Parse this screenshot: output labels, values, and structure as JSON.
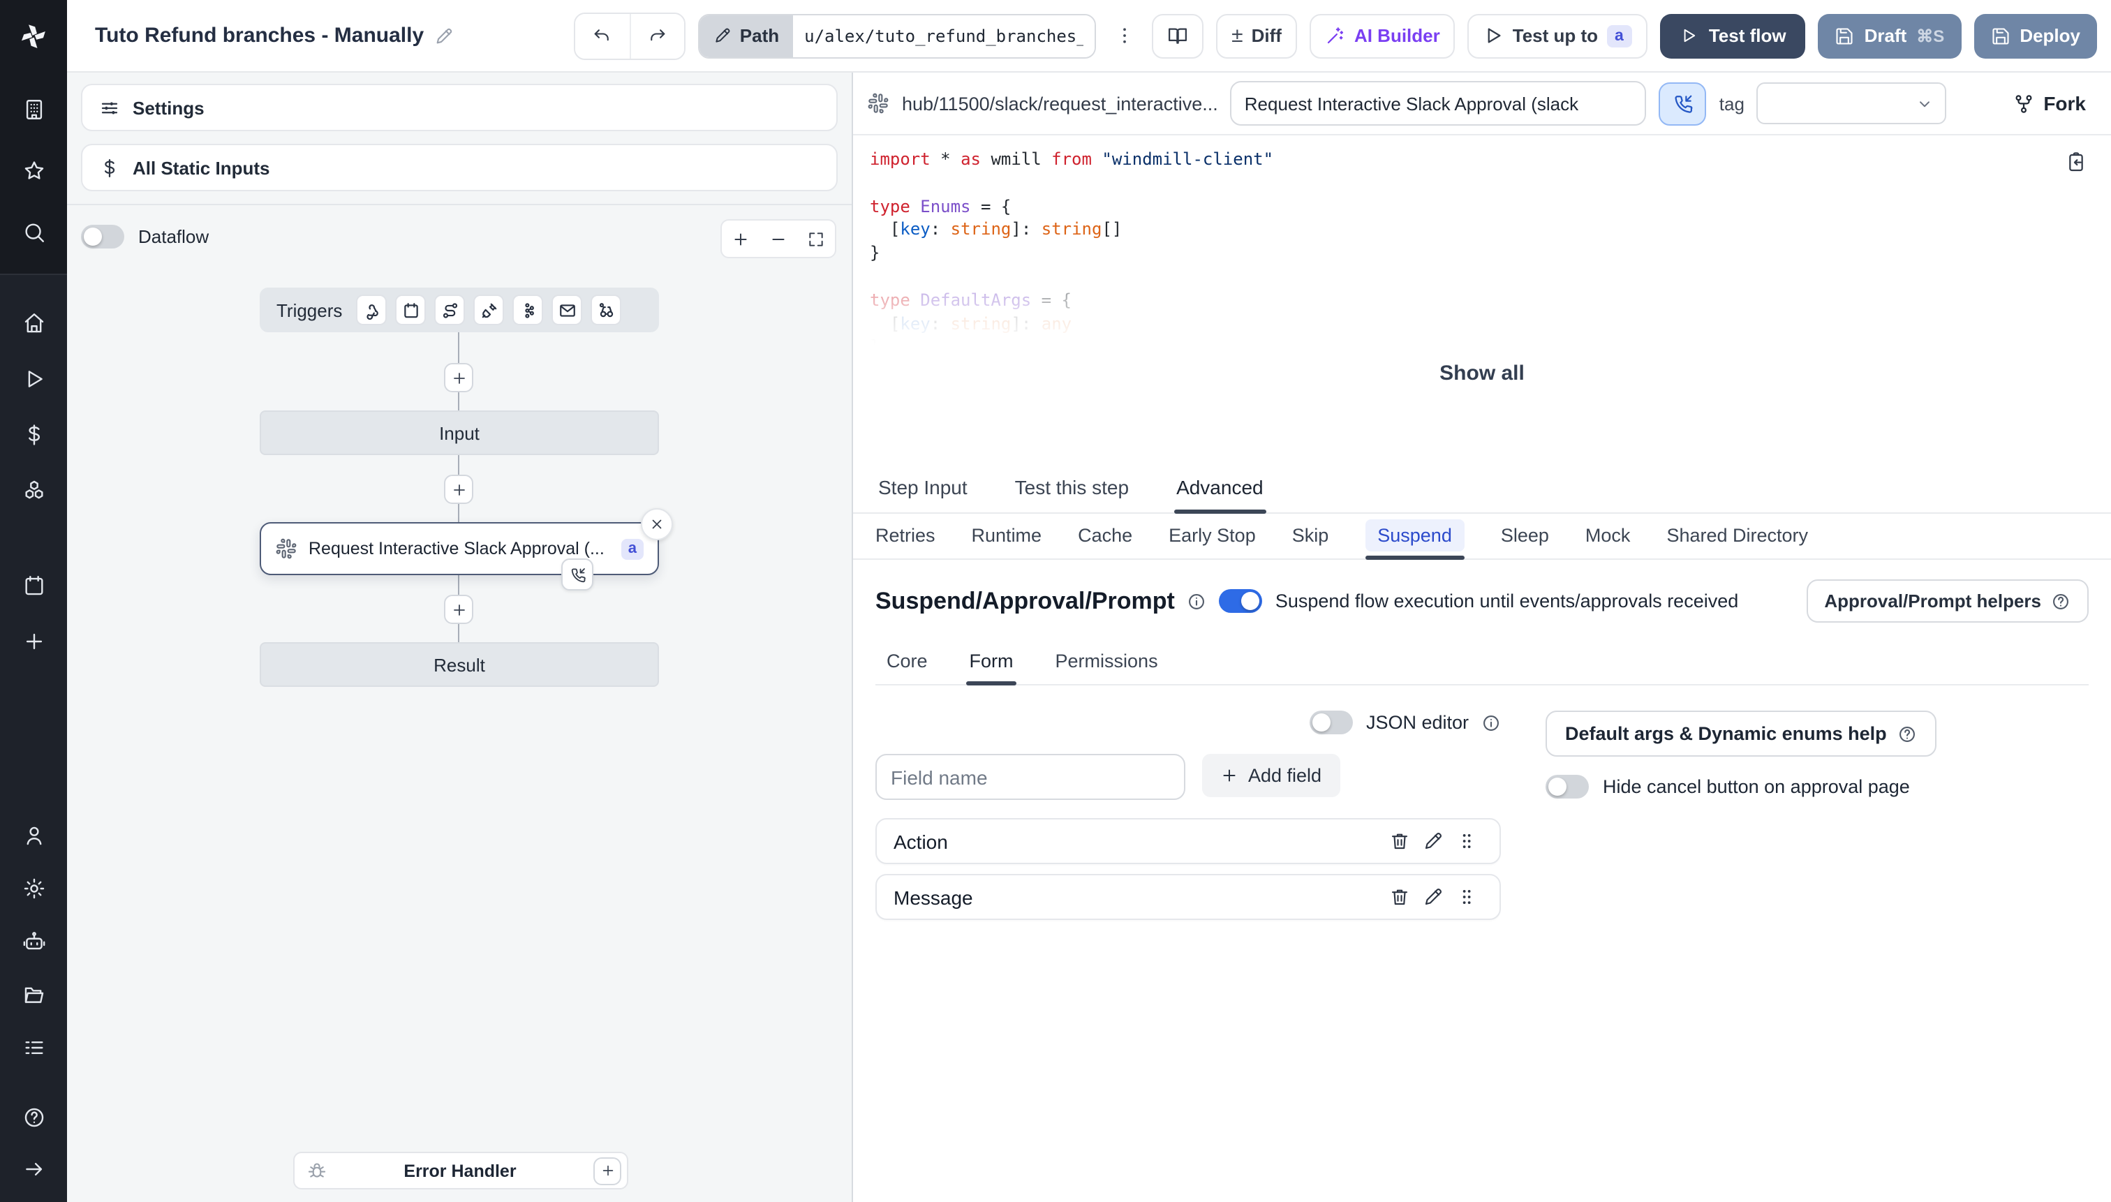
{
  "colors": {
    "rail_bg": "#1e222a",
    "accent_blue": "#2e6be6",
    "ai_purple": "#7a3ff2",
    "test_flow_bg": "#3a4861",
    "deploy_bg": "#6f86a6",
    "suspend_tab_blue": "#2b4acb",
    "node_border": "#4e5b77",
    "badge_bg": "#e3e6fb",
    "badge_text": "#4350d6"
  },
  "topbar": {
    "title": "Tuto Refund branches - Manually",
    "path_label": "Path",
    "path_value": "u/alex/tuto_refund_branches_",
    "diff_label": "Diff",
    "ai_builder_label": "AI Builder",
    "test_up_to_label": "Test up to",
    "test_up_to_badge": "a",
    "test_flow_label": "Test flow",
    "draft_label": "Draft",
    "draft_shortcut": "⌘S",
    "deploy_label": "Deploy"
  },
  "rail": {
    "top": [
      "building",
      "star",
      "search"
    ],
    "mid": [
      "home",
      "play",
      "dollar",
      "cubes"
    ],
    "mid2": [
      "calendar",
      "plus"
    ],
    "bottom": [
      "user",
      "gear",
      "bot",
      "folder",
      "list"
    ],
    "footer": [
      "help",
      "arrow-right"
    ]
  },
  "flow": {
    "settings_label": "Settings",
    "static_inputs_label": "All Static Inputs",
    "dataflow_label": "Dataflow",
    "triggers_label": "Triggers",
    "trigger_icons": [
      "webhook",
      "calendar",
      "route",
      "plug",
      "kafka",
      "mail",
      "poll"
    ],
    "input_label": "Input",
    "step_label": "Request Interactive Slack Approval (...",
    "step_badge": "a",
    "result_label": "Result",
    "error_handler_label": "Error Handler"
  },
  "step": {
    "hub_path": "hub/11500/slack/request_interactive...",
    "summary_value": "Request Interactive Slack Approval (slack",
    "tag_label": "tag",
    "fork_label": "Fork",
    "show_all_label": "Show all",
    "code_lines": [
      {
        "f": 0,
        "t": [
          [
            "k",
            "import "
          ],
          [
            "p",
            "* "
          ],
          [
            "k",
            "as "
          ],
          [
            "p",
            "wmill "
          ],
          [
            "k",
            "from "
          ],
          [
            "s",
            "\"windmill-client\""
          ]
        ]
      },
      {
        "f": 0,
        "t": []
      },
      {
        "f": 0,
        "t": [
          [
            "k",
            "type "
          ],
          [
            "ty",
            "Enums "
          ],
          [
            "p",
            "= {"
          ]
        ]
      },
      {
        "f": 0,
        "t": [
          [
            "p",
            "  ["
          ],
          [
            "v",
            "key"
          ],
          [
            "p",
            ": "
          ],
          [
            "o",
            "string"
          ],
          [
            "p",
            "]: "
          ],
          [
            "o",
            "string"
          ],
          [
            "p",
            "[]"
          ]
        ]
      },
      {
        "f": 0,
        "t": [
          [
            "p",
            "}"
          ]
        ]
      },
      {
        "f": 0,
        "t": []
      },
      {
        "f": 1,
        "t": [
          [
            "k",
            "type "
          ],
          [
            "ty",
            "DefaultArgs "
          ],
          [
            "p",
            "= {"
          ]
        ]
      },
      {
        "f": 2,
        "t": [
          [
            "p",
            "  ["
          ],
          [
            "v",
            "key"
          ],
          [
            "p",
            ": "
          ],
          [
            "o",
            "string"
          ],
          [
            "p",
            "]: "
          ],
          [
            "o",
            "any"
          ]
        ]
      },
      {
        "f": 3,
        "t": [
          [
            "p",
            "}"
          ]
        ]
      }
    ],
    "tabs": {
      "items": [
        "Step Input",
        "Test this step",
        "Advanced"
      ],
      "active": 2
    },
    "advanced_tabs": {
      "items": [
        "Retries",
        "Runtime",
        "Cache",
        "Early Stop",
        "Skip",
        "Suspend",
        "Sleep",
        "Mock",
        "Shared Directory"
      ],
      "active": 5
    },
    "suspend": {
      "heading": "Suspend/Approval/Prompt",
      "toggle_caption": "Suspend flow execution until events/approvals received",
      "helpers_button_label": "Approval/Prompt helpers",
      "sub_tabs": {
        "items": [
          "Core",
          "Form",
          "Permissions"
        ],
        "active": 1
      },
      "json_editor_label": "JSON editor",
      "field_name_placeholder": "Field name",
      "add_field_label": "Add field",
      "fields": [
        "Action",
        "Message"
      ],
      "default_args_button_label": "Default args & Dynamic enums help",
      "hide_cancel_label": "Hide cancel button on approval page"
    }
  }
}
